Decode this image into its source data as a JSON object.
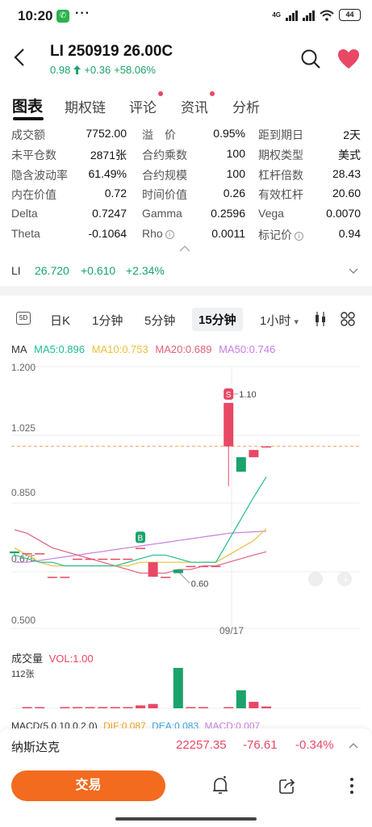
{
  "status_bar": {
    "time": "10:20",
    "dots": "···",
    "network": "4G",
    "battery": "44"
  },
  "header": {
    "title": "LI 250919 26.00C",
    "price": "0.98",
    "change": "+0.36",
    "change_pct": "+58.06%"
  },
  "tabs": [
    {
      "label": "图表",
      "active": true
    },
    {
      "label": "期权链",
      "active": false
    },
    {
      "label": "评论",
      "active": false,
      "dot": true
    },
    {
      "label": "资讯",
      "active": false,
      "dot": true
    },
    {
      "label": "分析",
      "active": false
    }
  ],
  "stats": [
    [
      {
        "label": "成交额",
        "value": "7752.00"
      },
      {
        "label": "溢　价",
        "value": "0.95%"
      },
      {
        "label": "距到期日",
        "value": "2天"
      }
    ],
    [
      {
        "label": "未平仓数",
        "value": "2871张"
      },
      {
        "label": "合约乘数",
        "value": "100"
      },
      {
        "label": "期权类型",
        "value": "美式"
      }
    ],
    [
      {
        "label": "隐含波动率",
        "value": "61.49%"
      },
      {
        "label": "合约规模",
        "value": "100"
      },
      {
        "label": "杠杆倍数",
        "value": "28.43"
      }
    ],
    [
      {
        "label": "内在价值",
        "value": "0.72"
      },
      {
        "label": "时间价值",
        "value": "0.26"
      },
      {
        "label": "有效杠杆",
        "value": "20.60"
      }
    ],
    [
      {
        "label": "Delta",
        "value": "0.7247"
      },
      {
        "label": "Gamma",
        "value": "0.2596"
      },
      {
        "label": "Vega",
        "value": "0.0070"
      }
    ],
    [
      {
        "label": "Theta",
        "value": "-0.1064"
      },
      {
        "label": "Rho",
        "value": "0.0011"
      },
      {
        "label": "标记价",
        "value": "0.94"
      }
    ]
  ],
  "underlying": {
    "symbol": "LI",
    "price": "26.720",
    "change": "+0.610",
    "change_pct": "+2.34%"
  },
  "periods": {
    "five_day": "5D",
    "items": [
      {
        "label": "日K",
        "active": false
      },
      {
        "label": "1分钟",
        "active": false
      },
      {
        "label": "5分钟",
        "active": false
      },
      {
        "label": "15分钟",
        "active": true
      },
      {
        "label": "1小时",
        "active": false
      }
    ],
    "dropdown_arrow": "▾"
  },
  "ma_legend": {
    "ma": "MA",
    "ma5": "MA5:0.896",
    "ma10": "MA10:0.753",
    "ma20": "MA20:0.689",
    "ma50": "MA50:0.746"
  },
  "colors": {
    "up": "#e84864",
    "down": "#1aa36a",
    "ma5": "#1fbc8e",
    "ma10": "#e9c13a",
    "ma20": "#e0607e",
    "ma50": "#c77fe0",
    "accent": "#f36b1f"
  },
  "chart_data": {
    "type": "candlestick",
    "y_ticks": [
      "1.200",
      "1.025",
      "0.850",
      "0.675",
      "0.500"
    ],
    "ylim": [
      0.5,
      1.2
    ],
    "x_label": "09/17",
    "current_price_line": 0.98,
    "annotations": {
      "high_label": "1.10",
      "low_label": "0.60",
      "sell_marker": "S",
      "buy_marker": "B"
    },
    "candles": [
      {
        "o": 0.69,
        "c": 0.685,
        "h": 0.69,
        "l": 0.68
      },
      {
        "o": 0.685,
        "c": 0.685,
        "h": 0.685,
        "l": 0.685
      },
      {
        "o": 0.685,
        "c": 0.685,
        "h": 0.685,
        "l": 0.685
      },
      {
        "o": 0.62,
        "c": 0.62,
        "h": 0.62,
        "l": 0.62
      },
      {
        "o": 0.62,
        "c": 0.62,
        "h": 0.62,
        "l": 0.62
      },
      {
        "o": 0.67,
        "c": 0.67,
        "h": 0.67,
        "l": 0.67
      },
      {
        "o": 0.67,
        "c": 0.67,
        "h": 0.67,
        "l": 0.67
      },
      {
        "o": 0.67,
        "c": 0.67,
        "h": 0.67,
        "l": 0.67
      },
      {
        "o": 0.67,
        "c": 0.67,
        "h": 0.67,
        "l": 0.67
      },
      {
        "o": 0.67,
        "c": 0.67,
        "h": 0.67,
        "l": 0.67
      },
      {
        "o": 0.7,
        "c": 0.7,
        "h": 0.7,
        "l": 0.7
      },
      {
        "o": 0.62,
        "c": 0.66,
        "h": 0.66,
        "l": 0.62
      },
      {
        "o": 0.62,
        "c": 0.62,
        "h": 0.62,
        "l": 0.62
      },
      {
        "o": 0.64,
        "c": 0.63,
        "h": 0.64,
        "l": 0.63
      },
      {
        "o": 0.65,
        "c": 0.65,
        "h": 0.65,
        "l": 0.65
      },
      {
        "o": 0.65,
        "c": 0.65,
        "h": 0.65,
        "l": 0.65
      },
      {
        "o": 0.65,
        "c": 0.65,
        "h": 0.65,
        "l": 0.65
      },
      {
        "o": 0.98,
        "c": 1.1,
        "h": 1.1,
        "l": 0.87
      },
      {
        "o": 0.95,
        "c": 0.91,
        "h": 0.95,
        "l": 0.91
      },
      {
        "o": 0.95,
        "c": 0.97,
        "h": 0.97,
        "l": 0.95
      },
      {
        "o": 0.98,
        "c": 0.98,
        "h": 0.98,
        "l": 0.98
      }
    ],
    "ma5": [
      0.68,
      0.67,
      0.66,
      0.66,
      0.65,
      0.65,
      0.65,
      0.65,
      0.65,
      0.66,
      0.67,
      0.68,
      0.68,
      0.67,
      0.66,
      0.66,
      0.66,
      0.72,
      0.78,
      0.84,
      0.896
    ],
    "ma10": [
      0.7,
      0.68,
      0.66,
      0.65,
      0.65,
      0.65,
      0.65,
      0.65,
      0.65,
      0.65,
      0.66,
      0.66,
      0.66,
      0.66,
      0.66,
      0.66,
      0.66,
      0.68,
      0.7,
      0.72,
      0.753
    ],
    "ma20": [
      0.75,
      0.74,
      0.72,
      0.7,
      0.69,
      0.68,
      0.67,
      0.66,
      0.65,
      0.64,
      0.63,
      0.63,
      0.63,
      0.64,
      0.64,
      0.65,
      0.65,
      0.66,
      0.67,
      0.68,
      0.689
    ],
    "ma50": [
      0.66,
      0.66,
      0.665,
      0.67,
      0.675,
      0.68,
      0.685,
      0.69,
      0.695,
      0.7,
      0.705,
      0.71,
      0.715,
      0.72,
      0.725,
      0.73,
      0.735,
      0.74,
      0.742,
      0.744,
      0.746
    ],
    "volume": {
      "label": "成交量",
      "vol_text": "VOL:1.00",
      "max_label": "112张",
      "values": [
        0,
        3,
        3,
        0,
        2,
        2,
        3,
        2,
        3,
        2,
        8,
        12,
        0,
        112,
        3,
        3,
        0,
        3,
        50,
        18,
        5
      ]
    },
    "macd": {
      "label": "MACD(5,0,10,0,2,0)",
      "dif": "DIF:0.087",
      "dea": "DEA:0.083",
      "macd": "MACD:0.007"
    }
  },
  "index_bar": {
    "name": "纳斯达克",
    "value": "22257.35",
    "change": "-76.61",
    "change_pct": "-0.34%"
  },
  "action_bar": {
    "trade_label": "交易"
  }
}
